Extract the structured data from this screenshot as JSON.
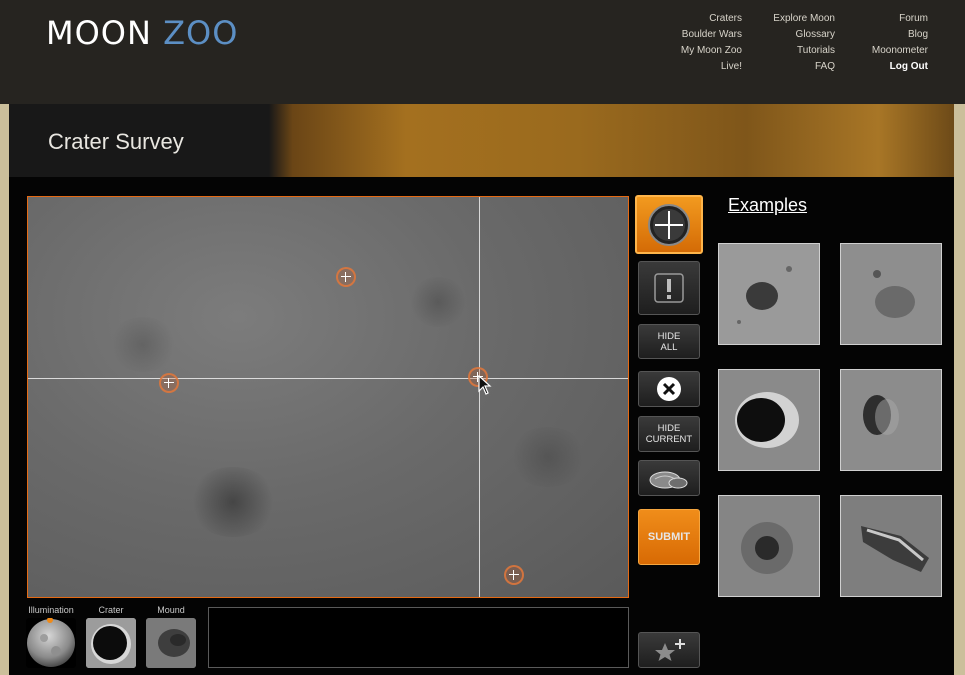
{
  "logo": {
    "moon": "MOON",
    "zoo": "ZOO"
  },
  "nav": {
    "col1": [
      "Craters",
      "Boulder Wars",
      "My Moon Zoo",
      "Live!"
    ],
    "col2": [
      "Explore Moon",
      "Glossary",
      "Tutorials",
      "FAQ"
    ],
    "col3": [
      "Forum",
      "Blog",
      "Moonometer",
      "Log Out"
    ]
  },
  "page": {
    "title": "Crater Survey"
  },
  "tools": {
    "crater": {
      "icon": "crosshair-icon"
    },
    "alert": {
      "icon": "exclamation-icon"
    },
    "hide_all": "HIDE ALL",
    "delete": {
      "icon": "close-icon"
    },
    "hide_current": "HIDE CURRENT",
    "boulder": {
      "icon": "boulder-icon"
    },
    "submit": "SUBMIT",
    "favourite": {
      "icon": "star-plus-icon"
    }
  },
  "bottom": {
    "illumination": "Illumination",
    "crater": "Crater",
    "mound": "Mound"
  },
  "examples": {
    "title": "Examples"
  },
  "colors": {
    "accent_orange": "#e97f0f",
    "header_bg": "#262420",
    "zoo_blue": "#5c8fc4"
  }
}
